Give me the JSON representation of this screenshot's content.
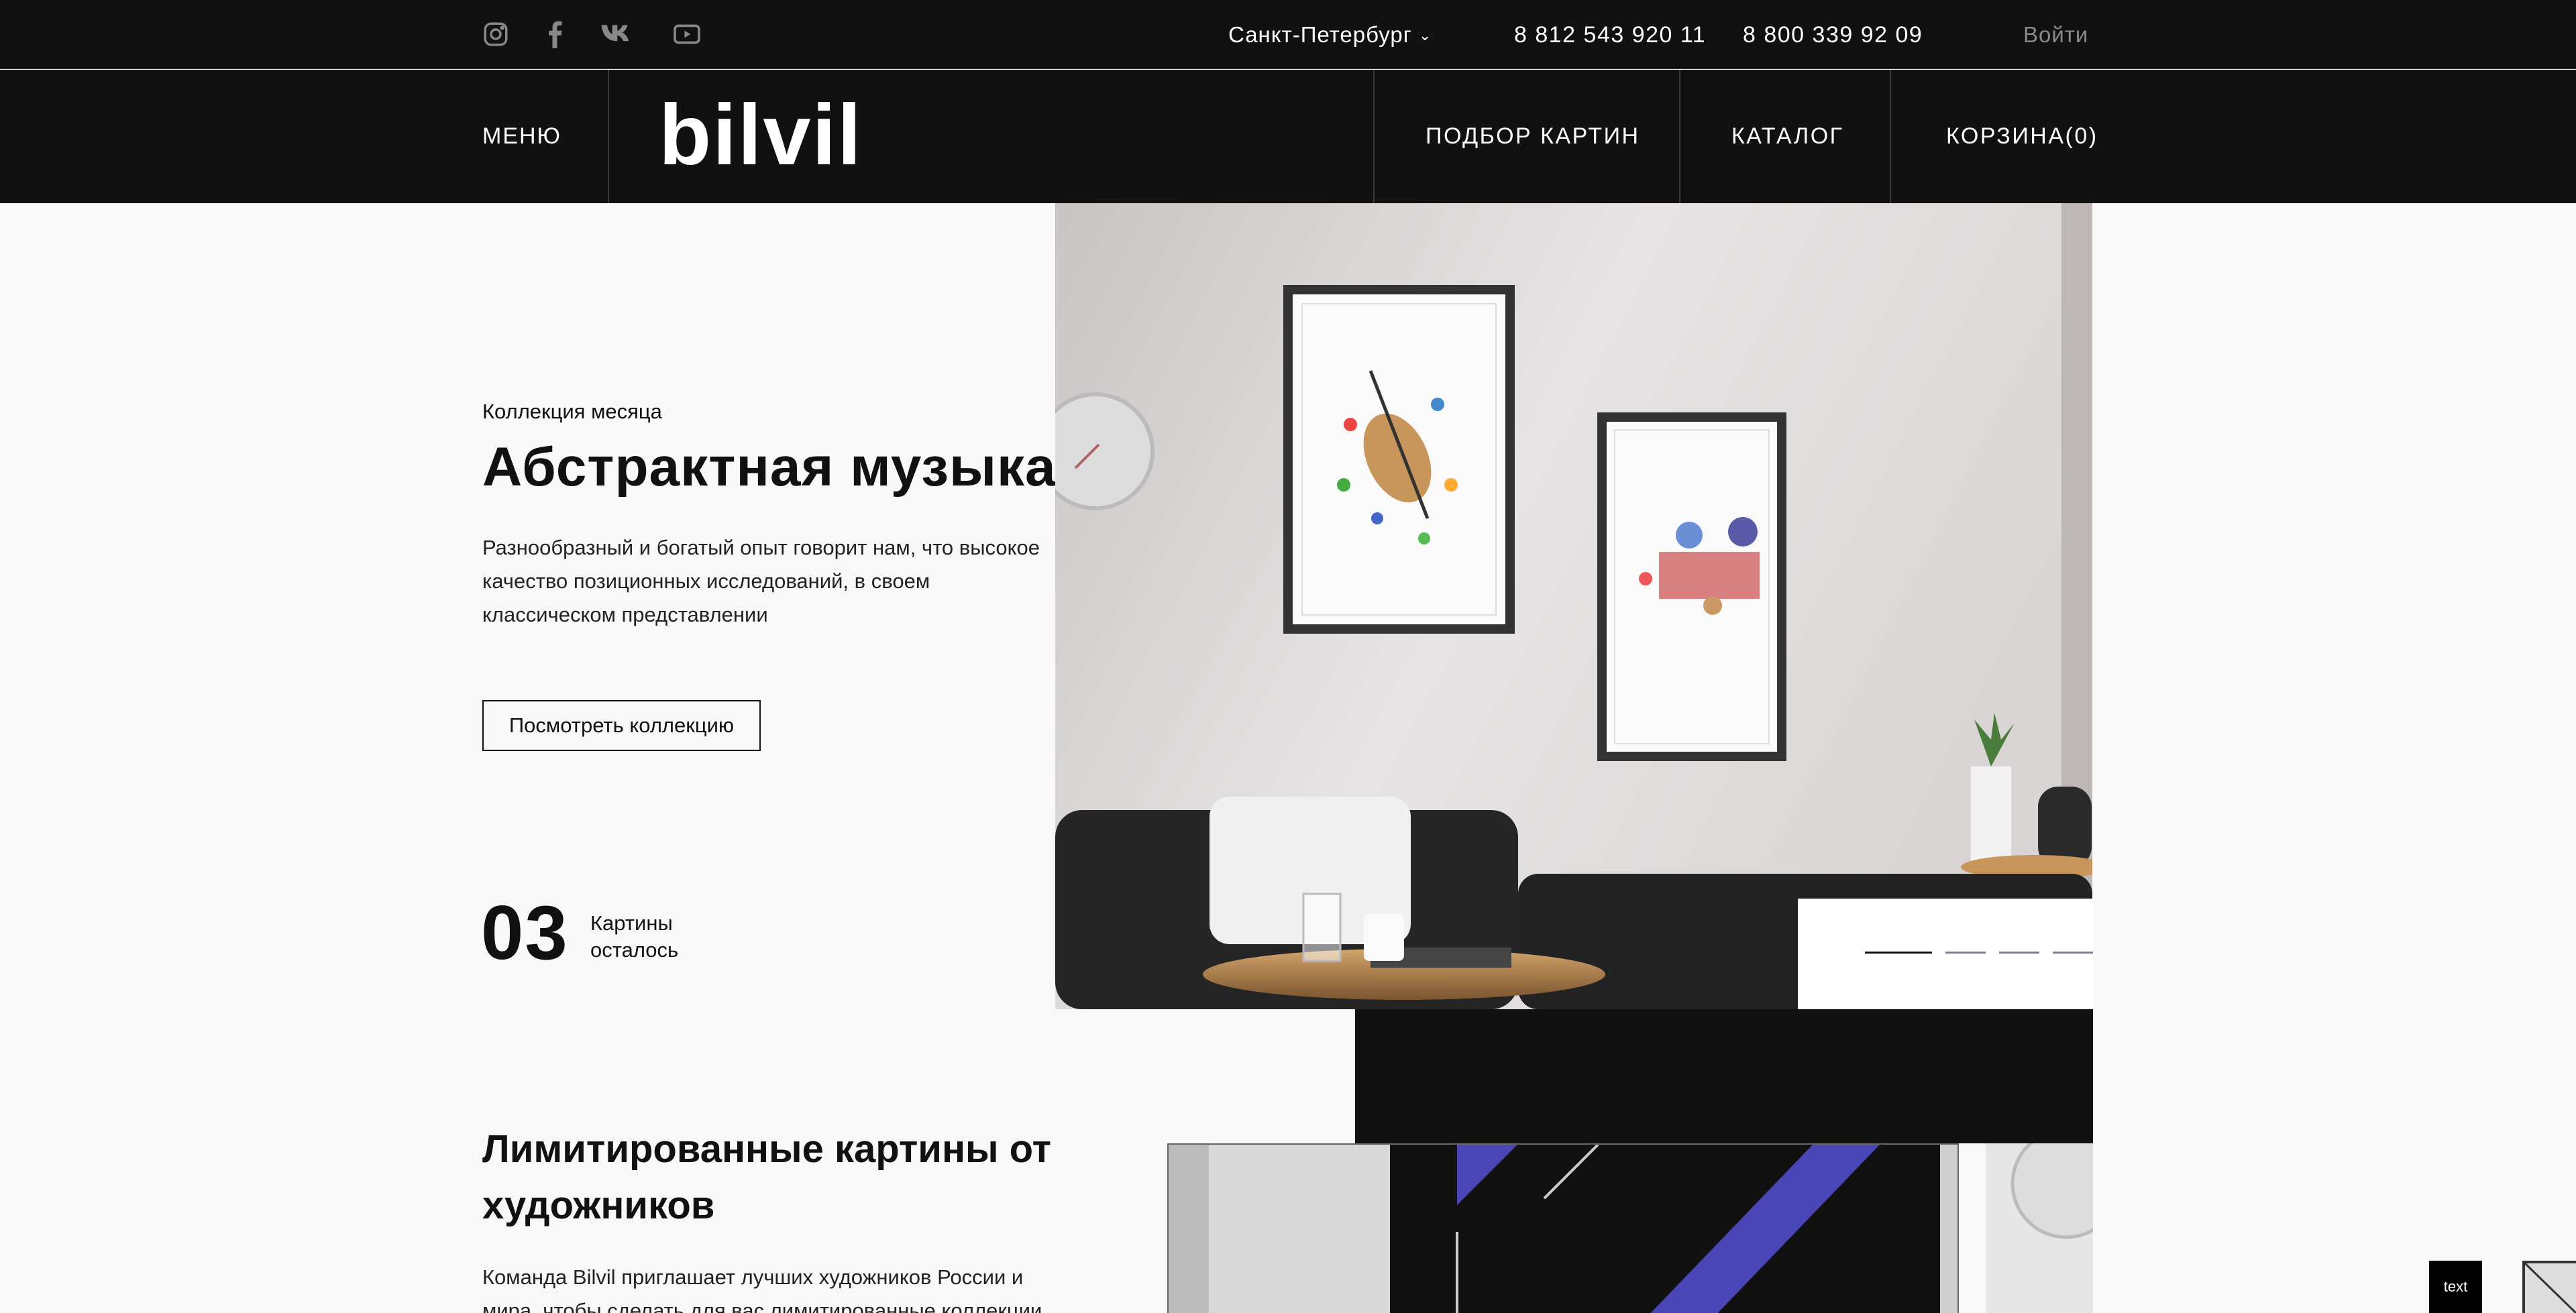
{
  "topbar": {
    "social_icons": [
      "instagram-icon",
      "facebook-icon",
      "vk-icon",
      "youtube-icon"
    ],
    "city": "Санкт-Петербург",
    "phone_1": "8 812 543 920 11",
    "phone_2": "8 800 339 92 09",
    "login": "Войти"
  },
  "nav": {
    "menu": "МЕНЮ",
    "logo": "bilvil",
    "items": [
      "ПОДБОР КАРТИН",
      "КАТАЛОГ",
      "КОРЗИНА(0)"
    ]
  },
  "hero": {
    "eyebrow": "Коллекция месяца",
    "title": "Абстрактная музыка",
    "text": "Разнообразный и богатый опыт говорит нам, что высокое качество позиционных исследований, в своем классическом представлении",
    "button": "Посмотреть коллекцию",
    "count": "03",
    "count_label_1": "Картины",
    "count_label_2": "осталось",
    "active_slide": 1,
    "slide_count": 4
  },
  "section": {
    "title": "Лимитированные картины от художников",
    "text": "Команда Bilvil приглашает лучших художников России и мира, чтобы сделать для вас лимитированные коллекции"
  },
  "badge": {
    "text": "text"
  },
  "colors": {
    "background": "#f8f8f8",
    "header": "#111111",
    "accent_blue": "#4a46b8"
  }
}
